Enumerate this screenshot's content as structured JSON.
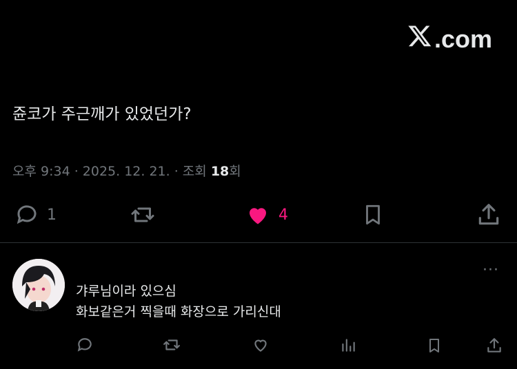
{
  "brand": {
    "logo_icon": "x-logo-icon",
    "text": ".com"
  },
  "tweet": {
    "text": "쥰코가 주근깨가 있었던가?",
    "meta_prefix": "오후 9:34 · 2025. 12. 21. · 조회 ",
    "views": "18",
    "views_suffix": "회"
  },
  "actions": {
    "reply_count": "1",
    "like_count": "4",
    "liked_color": "#f91880"
  },
  "reply": {
    "line1": "갸루님이라 있으심",
    "line2": "화보같은거 찍을때 화장으로 가리신대",
    "more_label": "···"
  }
}
